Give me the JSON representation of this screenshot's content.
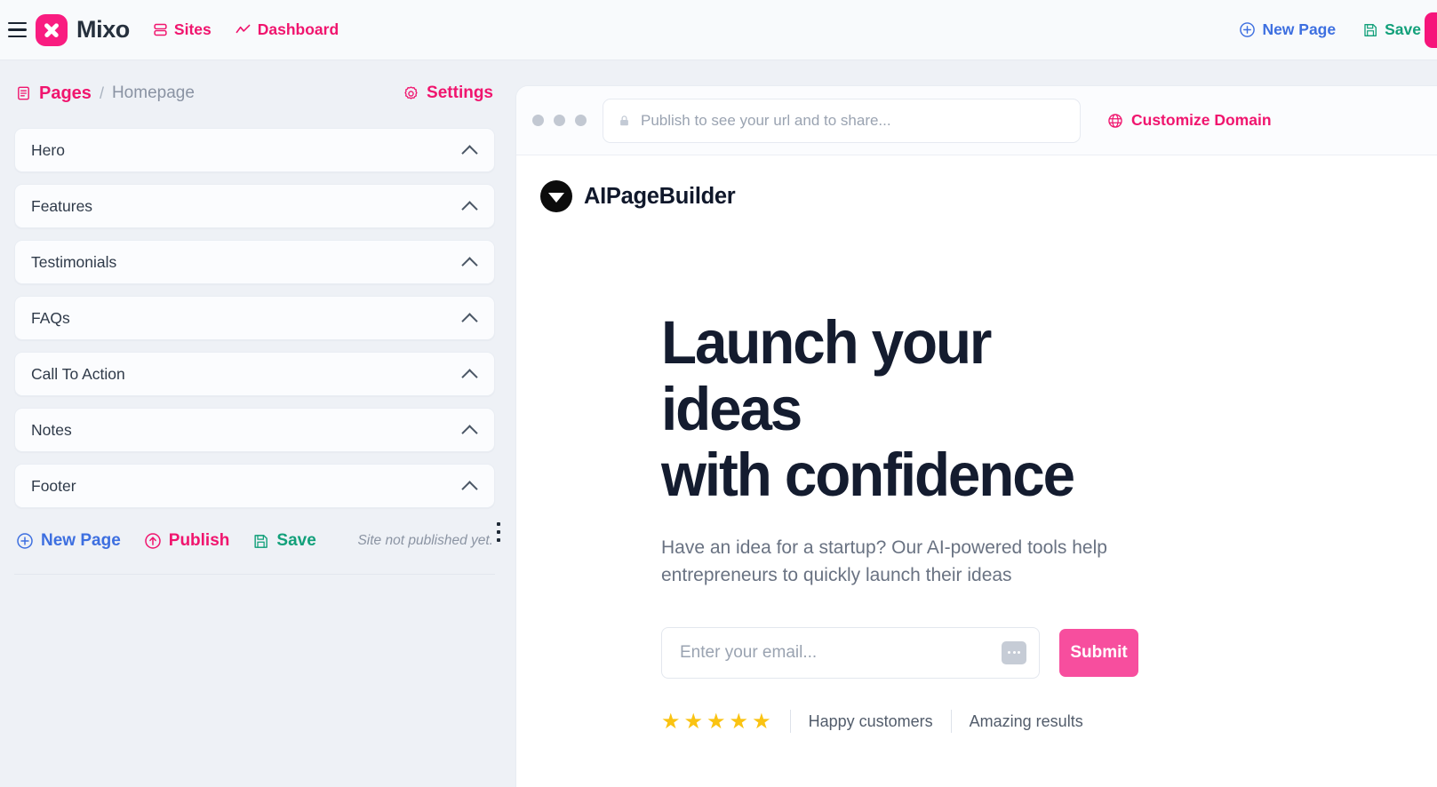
{
  "header": {
    "menu_icon": "hamburger-icon",
    "brand": {
      "name": "Mixo",
      "icon": "x-logo-icon"
    },
    "nav": [
      {
        "label": "Sites",
        "icon": "sites-icon"
      },
      {
        "label": "Dashboard",
        "icon": "chart-line-icon"
      }
    ],
    "actions": [
      {
        "label": "New Page",
        "icon": "plus-circle-icon",
        "color": "#3d6fe0"
      },
      {
        "label": "Save",
        "icon": "floppy-disk-icon",
        "color": "#12a07a"
      }
    ],
    "edge_button": {
      "name": "side-drawer-toggle",
      "color": "#f6157b"
    }
  },
  "sidebar": {
    "breadcrumb": {
      "root": "Pages",
      "root_icon": "pages-list-icon",
      "separator": "/",
      "current": "Homepage"
    },
    "settings": {
      "label": "Settings",
      "icon": "gear-icon"
    },
    "sections": [
      {
        "label": "Hero",
        "chevron": "chevron-up-icon"
      },
      {
        "label": "Features",
        "chevron": "chevron-up-icon"
      },
      {
        "label": "Testimonials",
        "chevron": "chevron-up-icon"
      },
      {
        "label": "FAQs",
        "chevron": "chevron-up-icon"
      },
      {
        "label": "Call To Action",
        "chevron": "chevron-up-icon"
      },
      {
        "label": "Notes",
        "chevron": "chevron-up-icon"
      },
      {
        "label": "Footer",
        "chevron": "chevron-up-icon"
      }
    ],
    "actions": [
      {
        "label": "New Page",
        "icon": "plus-circle-icon",
        "color": "#3d6fe0"
      },
      {
        "label": "Publish",
        "icon": "upload-circle-icon",
        "color": "#f0156e"
      },
      {
        "label": "Save",
        "icon": "floppy-disk-icon",
        "color": "#12a07a"
      }
    ],
    "publish_status": "Site not published yet.",
    "resize_handle": "vertical-dots-handle"
  },
  "preview": {
    "browser_bar": {
      "dots": 3,
      "url_placeholder": "Publish to see your url and to share...",
      "lock_icon": "lock-icon",
      "customize_domain": {
        "label": "Customize Domain",
        "icon": "globe-icon"
      }
    },
    "site": {
      "logo": {
        "icon": "down-triangle-circle-icon",
        "name": "AIPageBuilder"
      },
      "hero": {
        "heading_line1": "Launch your ideas",
        "heading_line2": "with confidence",
        "subheading": "Have an idea for a startup? Our AI-powered tools help entrepreneurs to quickly launch their ideas",
        "email_placeholder": "Enter your email...",
        "email_chip": "ellipsis-icon",
        "submit_label": "Submit",
        "submit_color": "#f74e9e",
        "stars": 5,
        "star_color": "#fac312",
        "proof_items": [
          "Happy customers",
          "Amazing results"
        ]
      }
    }
  }
}
